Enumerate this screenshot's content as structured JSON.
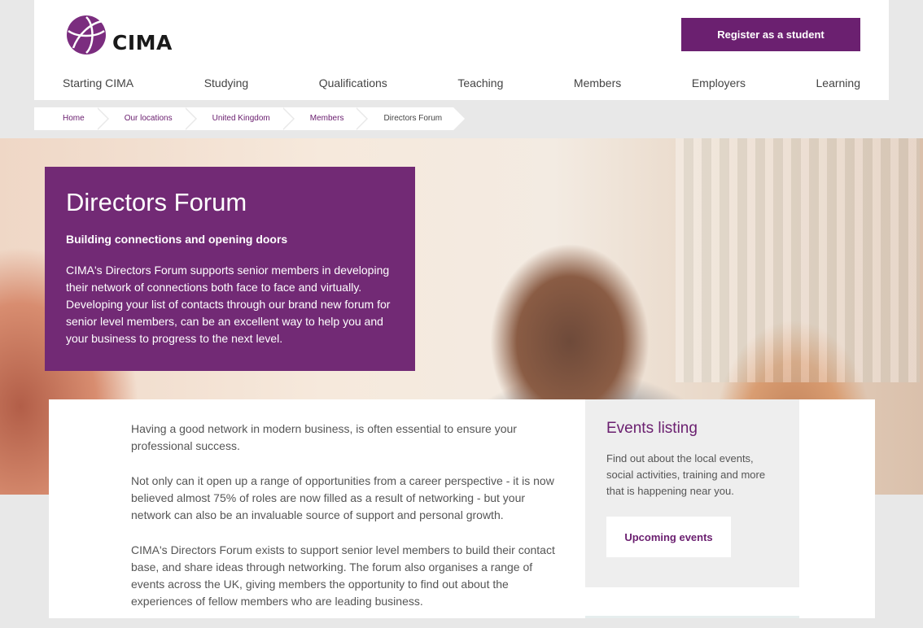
{
  "header": {
    "logo_text": "CIMA",
    "register_label": "Register as a student",
    "accent": "#6b2070"
  },
  "nav": {
    "items": [
      "Starting CIMA",
      "Studying",
      "Qualifications",
      "Teaching",
      "Members",
      "Employers",
      "Learning"
    ]
  },
  "breadcrumb": {
    "items": [
      "Home",
      "Our locations",
      "United Kingdom",
      "Members",
      "Directors Forum"
    ]
  },
  "hero": {
    "title": "Directors Forum",
    "subtitle": "Building connections and opening doors",
    "text": "CIMA's Directors Forum supports senior members in developing their network of connections both face to face and virtually. Developing your list of contacts through our brand new forum for senior level members, can be an excellent way to help you and your business to progress to the next level.",
    "panel_color": "#722a75"
  },
  "main": {
    "paragraphs": [
      "Having a good network in modern business, is often essential to ensure your professional success.",
      "Not only can it open up a range of opportunities from a career perspective - it is now believed almost 75% of roles are now filled as a result of networking - but your network can also be an invaluable source of support and personal growth.",
      "CIMA's Directors Forum exists to support senior level members to build their contact base, and share ideas through networking. The forum also organises a range of events across the UK, giving members the opportunity to find out about the experiences of fellow members who are leading business."
    ]
  },
  "sidebar": {
    "title": "Events listing",
    "text": "Find out about the local events, social activities, training and more that is happening near you.",
    "button_label": "Upcoming events"
  }
}
